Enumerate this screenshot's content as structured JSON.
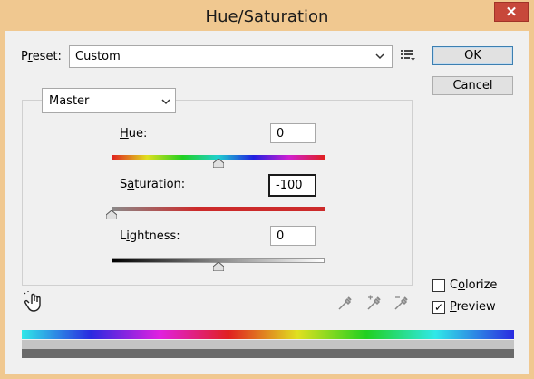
{
  "window": {
    "title": "Hue/Saturation",
    "close_glyph": "✕"
  },
  "preset": {
    "label": "Preset:",
    "value": "Custom",
    "options_icon": "preset-options-icon"
  },
  "buttons": {
    "ok": "OK",
    "cancel": "Cancel"
  },
  "channel": {
    "value": "Master"
  },
  "hue": {
    "label": "Hue:",
    "value": "0",
    "fraction": 0.5
  },
  "saturation": {
    "label": "Saturation:",
    "value": "-100",
    "fraction": 0.0
  },
  "lightness": {
    "label": "Lightness:",
    "value": "0",
    "fraction": 0.5
  },
  "colorize": {
    "label": "Colorize",
    "checked": false
  },
  "preview": {
    "label": "Preview",
    "checked": true,
    "check_glyph": "✓"
  },
  "colors": {
    "accent": "#3c7fb1",
    "close": "#c7483a",
    "saturation_red": "#cc2a2a",
    "output_bar_gray": "#b8b8b8",
    "output_bar_dark": "#6a6a6a"
  }
}
